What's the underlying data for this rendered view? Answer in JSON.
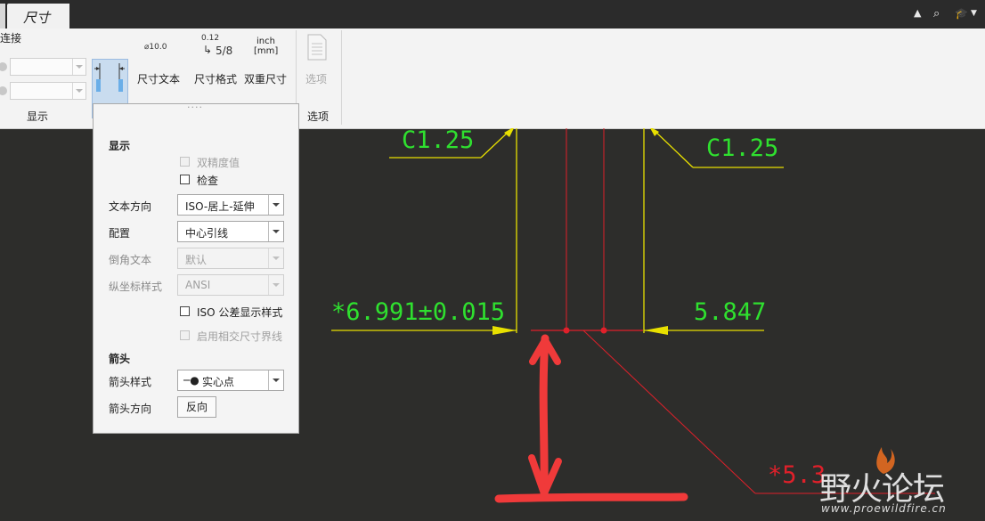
{
  "titlebar": {
    "tab_label": "尺寸"
  },
  "ribbon": {
    "connect_label": "连接",
    "group_display_label": "显示",
    "display_button_label": "显示",
    "dim_text_button_label": "尺寸文本",
    "dim_text_icon_text": "⌀10.0",
    "dim_format_button_label": "尺寸格式",
    "dim_format_icon_top": "0.12",
    "dim_format_icon_bottom": "5/8",
    "dual_dim_button_label": "双重尺寸",
    "dual_dim_icon_top": "inch",
    "dual_dim_icon_bottom": "[mm]",
    "options_button_label": "选项",
    "group_options_label": "选项",
    "more_dots": "...."
  },
  "panel": {
    "section_display": "显示",
    "dual_precision_label": "双精度值",
    "inspect_label": "检查",
    "text_orientation_label": "文本方向",
    "text_orientation_value": "ISO-居上-延伸",
    "config_label": "配置",
    "config_value": "中心引线",
    "chamfer_text_label": "倒角文本",
    "chamfer_text_value": "默认",
    "ordinate_style_label": "纵坐标样式",
    "ordinate_style_value": "ANSI",
    "iso_tolerance_label": "ISO 公差显示样式",
    "intersecting_lines_label": "启用相交尺寸界线",
    "section_arrow": "箭头",
    "arrow_style_label": "箭头样式",
    "arrow_style_value": "实心点",
    "arrow_direction_label": "箭头方向",
    "reverse_button_label": "反向"
  },
  "drawing": {
    "chamfer_left": "C1.25",
    "chamfer_right": "C1.25",
    "dim_left": "*6.991±0.015",
    "dim_right": "5.847",
    "dim_bottom": "*5.3"
  },
  "watermark": {
    "brand": "野火论坛",
    "url": "www.proewildfire.cn"
  },
  "colors": {
    "canvas_bg": "#2d2d2b",
    "dim_text": "#2fe02f",
    "dim_line": "#e8e000",
    "center_line": "#e0202a",
    "annotation": "#f03a3a"
  }
}
